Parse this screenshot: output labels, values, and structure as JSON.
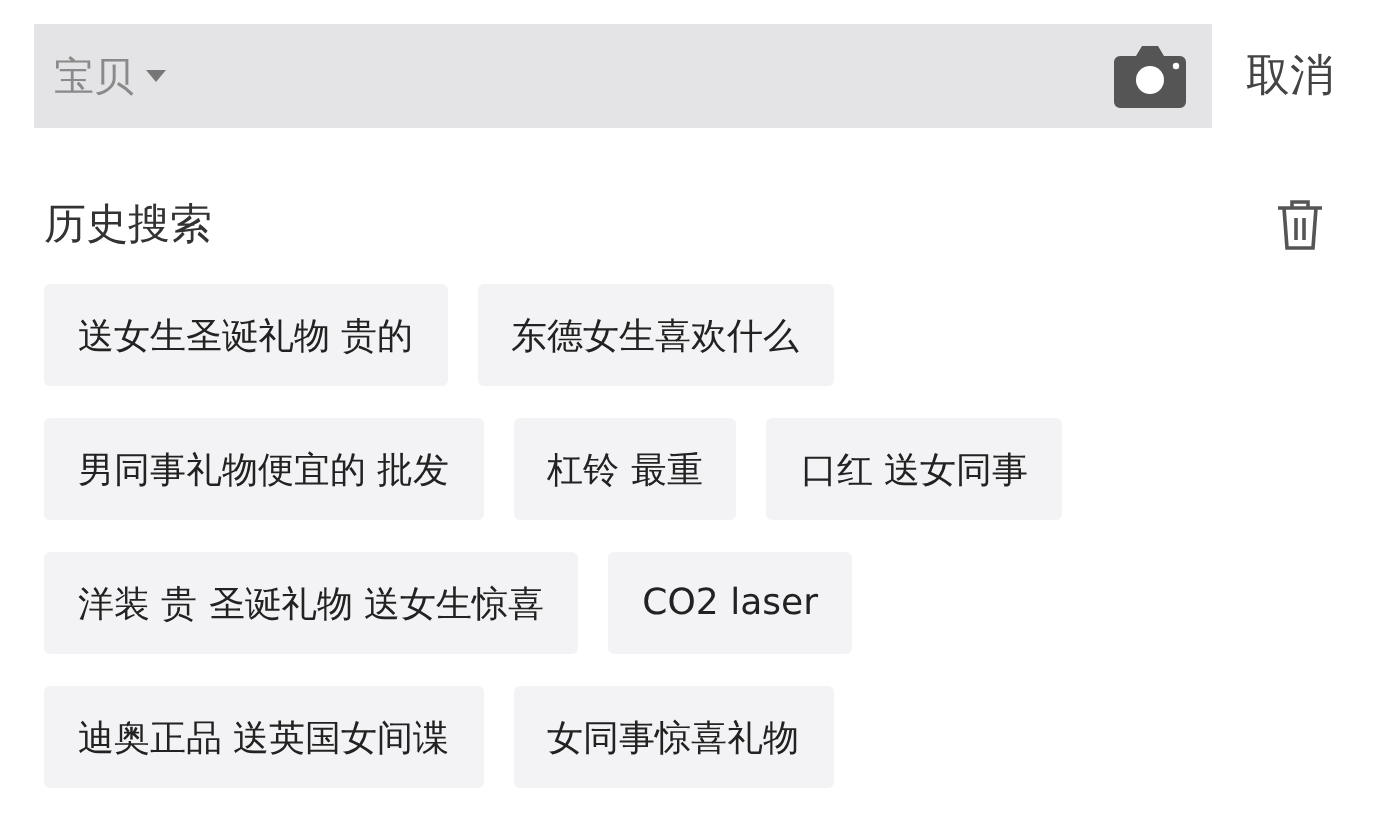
{
  "search_bar": {
    "scope": "宝贝",
    "cancel": "取消"
  },
  "history": {
    "title": "历史搜索",
    "rows": [
      [
        "送女生圣诞礼物 贵的",
        "东德女生喜欢什么"
      ],
      [
        "男同事礼物便宜的 批发",
        "杠铃 最重",
        "口红 送女同事"
      ],
      [
        "洋装 贵 圣诞礼物 送女生惊喜",
        "CO2 laser"
      ],
      [
        "迪奥正品 送英国女间谍",
        "女同事惊喜礼物"
      ]
    ]
  }
}
